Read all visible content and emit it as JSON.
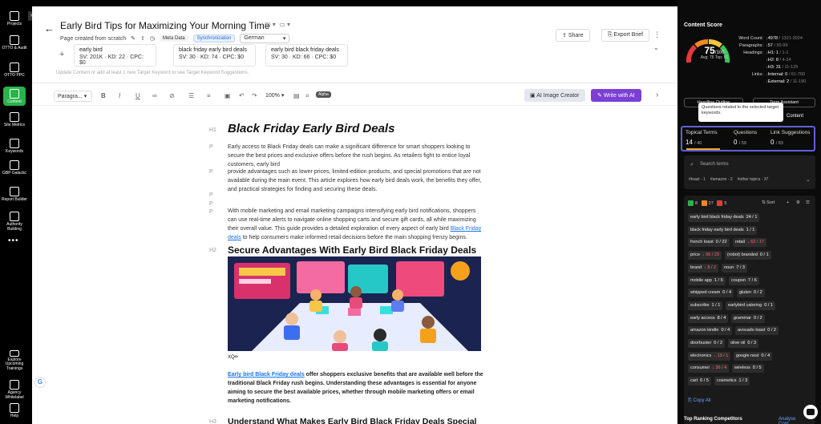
{
  "nav": {
    "items": [
      {
        "label": "Projects",
        "icon": "folder-icon"
      },
      {
        "label": "OTTO & Audit",
        "icon": "audit-icon"
      },
      {
        "label": "OTTO PPC",
        "icon": "ppc-icon"
      },
      {
        "label": "Content",
        "icon": "pencil-icon"
      },
      {
        "label": "Site Metrics",
        "icon": "metrics-icon"
      },
      {
        "label": "Keywords",
        "icon": "key-icon"
      },
      {
        "label": "GBP Galactic",
        "icon": "map-pin-icon"
      },
      {
        "label": "Report Builder",
        "icon": "report-icon"
      },
      {
        "label": "Authority Building",
        "icon": "megaphone-icon"
      }
    ],
    "bottom": [
      {
        "label": "Explore Upcoming Trainings",
        "icon": "calendar-icon"
      },
      {
        "label": "Agency Whitelabel",
        "icon": "agency-icon"
      },
      {
        "label": "Help",
        "icon": "help-icon"
      }
    ],
    "active_color": "#2ab34a"
  },
  "header": {
    "title": "Early Bird Tips for Maximizing Your Morning Time",
    "subtitle": "Page created from scratch",
    "meta_tag": "Meta Data",
    "sync_tag": "Synchronization",
    "language": "German",
    "share": "Share",
    "export": "Export Brief"
  },
  "keywords": [
    {
      "kw": "early bird",
      "sv": "SV: 201K",
      "kd": "KD: 22",
      "cpc": "CPC: $0"
    },
    {
      "kw": "black friday early bird deals",
      "sv": "SV: 30",
      "kd": "KD: 74",
      "cpc": "CPC: $0"
    },
    {
      "kw": "early bird black friday deals",
      "sv": "SV: 30",
      "kd": "KD: 66",
      "cpc": "CPC: $0"
    }
  ],
  "keyword_hint": "Update Content or add at least 1 new Target Keyword to see Target Keyword Suggestions.",
  "toolbar": {
    "paragraph": "Paragra...",
    "zoom": "100%",
    "alpha": "Alpha",
    "ai_image": "AI Image Creator",
    "write_ai": "Write with AI",
    "write_color": "#7b3fd6"
  },
  "doc": {
    "h1_marker": "H1",
    "p_marker": "P",
    "h2_marker": "H2",
    "h3_marker": "H3",
    "h1": "Black Friday Early Bird Deals",
    "p1": "Early access to Black Friday deals can make a significant difference for smart shoppers looking to secure the best prices and exclusive offers before the rush begins. As retailers fight to entice loyal customers, early bird",
    "p2": "provide advantages such as lower prices, limited-edition products, and special promotions that are not available during the main event. This article explores how early bird deals work, the benefits they offer, and practical strategies for finding and securing these deals.",
    "p3_a": "With mobile marketing and email marketing campaigns intensifying early bird notifications, shoppers can use real-time alerts to navigate online shopping carts and secure gift cards, all while maximizing their overall value. This guide provides a detailed exploration of every aspect of early bird ",
    "p3_link": "Black Friday deals",
    "p3_b": " to help consumers make informed retail decisions before the main shopping frenzy begins.",
    "h2": "Secure Advantages With Early Bird Black Friday Deals",
    "image_caption": "XQ✏",
    "p4_link": "Early bird Black Friday deals",
    "p4": " offer shoppers exclusive benefits that are available well before the traditional Black Friday rush begins. Understanding these advantages is essential for anyone aiming to secure the best available prices, whether through mobile marketing offers or email marketing notifications.",
    "h3": "Understand What Makes Early Bird Black Friday Deals Special"
  },
  "panel": {
    "title": "Content Score",
    "score": "75",
    "score_max": "/100",
    "score_sub": "Avg: 75 Top: 81",
    "stats": [
      {
        "k": "Word Count:",
        "arrow": "↓",
        "arrow_color": "red",
        "v": "4978",
        "range": "/ 1321-3024"
      },
      {
        "k": "Paragraphs:",
        "arrow": "↓",
        "arrow_color": "green",
        "v": "57",
        "range": "/ 50-99"
      },
      {
        "k": "Headings:",
        "arrow": "↓",
        "arrow_color": "red",
        "v": "H1: 1",
        "range": "/ 1-1"
      },
      {
        "k": "",
        "arrow": "↓",
        "arrow_color": "green",
        "v": "H2: 8",
        "range": "/ 4-24"
      },
      {
        "k": "",
        "arrow": "↓",
        "arrow_color": "green",
        "v": "H3: 31",
        "range": "/ 11-125"
      },
      {
        "k": "Links:",
        "arrow": "↓",
        "arrow_color": "red",
        "v": "Internal: 0",
        "range": "/ 61-760"
      },
      {
        "k": "",
        "arrow": "↓",
        "arrow_color": "red",
        "v": "External: 2",
        "range": "/ 11-190"
      }
    ],
    "tab_left": "Headline Outline",
    "tab_right": "Term Assistant",
    "content_btn": "Content",
    "tooltip": "Questions related to the selected target keywords.",
    "topical": {
      "label": "Topical Terms",
      "count": "14",
      "total": "/ 40"
    },
    "questions": {
      "label": "Questions",
      "count": "0",
      "total": "/ 59"
    },
    "links": {
      "label": "Link Suggestions",
      "count": "0",
      "total": "/ 83"
    },
    "search_placeholder": "Search terms",
    "filters": [
      "#toast - 1",
      "#amazon - 2",
      "#other topics - 37"
    ],
    "counts": {
      "green": "8",
      "orange": "27",
      "red": "5"
    },
    "sort": "Sort",
    "copy_all": "Copy All",
    "competitors": "Top Ranking Competitors",
    "analyse": "Analyse Com..."
  },
  "terms": [
    {
      "t": "early bird black friday deals",
      "c": "24 / 1",
      "red": false
    },
    {
      "t": "black friday early bird deals",
      "c": "1 / 1",
      "red": false
    },
    {
      "t": "french toast",
      "c": "0 / 22",
      "red": false
    },
    {
      "t": "retail",
      "c": "62 / 17",
      "red": true
    },
    {
      "t": "price",
      "c": "56 / 23",
      "red": true
    },
    {
      "t": "(robot) branded",
      "c": "0 / 1",
      "red": false
    },
    {
      "t": "brand",
      "c": "8 / 2",
      "red": true
    },
    {
      "t": "noun",
      "c": "7 / 3",
      "red": false
    },
    {
      "t": "mobile app",
      "c": "1 / 5",
      "red": false
    },
    {
      "t": "coupon",
      "c": "7 / 6",
      "red": false
    },
    {
      "t": "whipped cream",
      "c": "0 / 4",
      "red": false
    },
    {
      "t": "gluten",
      "c": "0 / 2",
      "red": false
    },
    {
      "t": "subscribe",
      "c": "1 / 1",
      "red": false
    },
    {
      "t": "earlybird catering",
      "c": "0 / 1",
      "red": false
    },
    {
      "t": "early access",
      "c": "8 / 4",
      "red": false
    },
    {
      "t": "grammar",
      "c": "0 / 2",
      "red": false
    },
    {
      "t": "amazon kindle",
      "c": "0 / 4",
      "red": false
    },
    {
      "t": "avocado toast",
      "c": "0 / 2",
      "red": false
    },
    {
      "t": "doorbuster",
      "c": "0 / 2",
      "red": false
    },
    {
      "t": "olive oil",
      "c": "0 / 3",
      "red": false
    },
    {
      "t": "electronics",
      "c": "13 / 1",
      "red": true
    },
    {
      "t": "google nest",
      "c": "0 / 4",
      "red": false
    },
    {
      "t": "consumer",
      "c": "36 / 4",
      "red": true
    },
    {
      "t": "wireless",
      "c": "0 / 5",
      "red": false
    },
    {
      "t": "cart",
      "c": "6 / 5",
      "red": false
    },
    {
      "t": "cosmetics",
      "c": "1 / 3",
      "red": false
    }
  ]
}
